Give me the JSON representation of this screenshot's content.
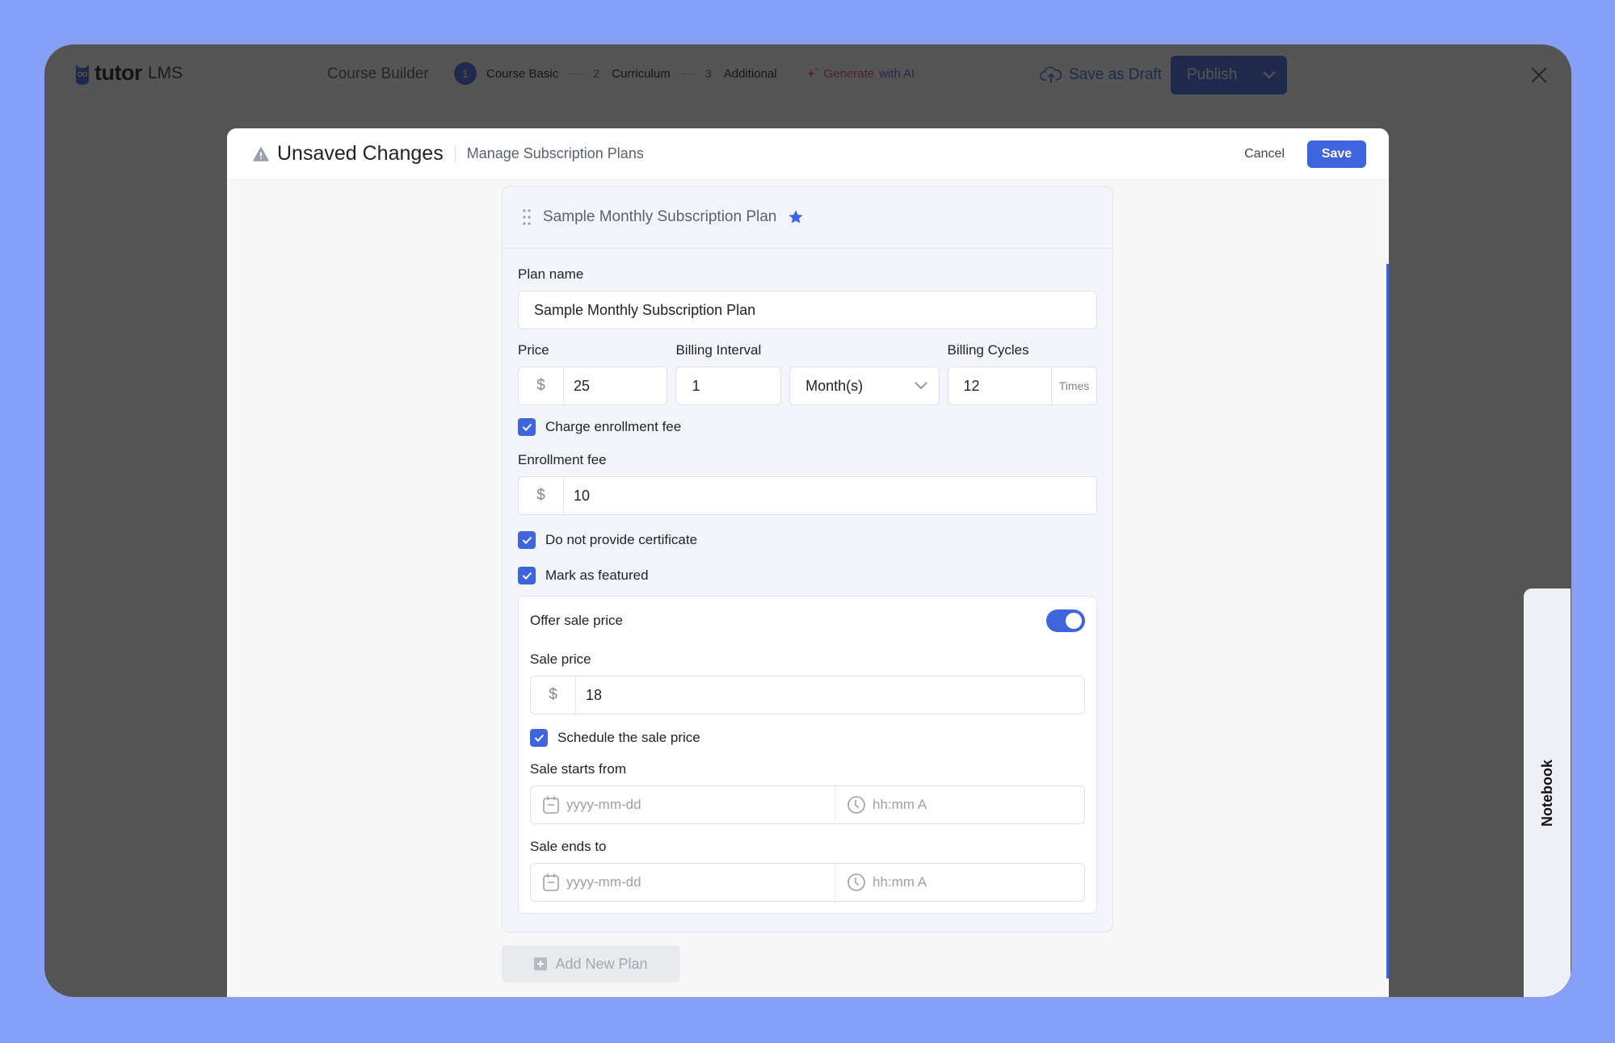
{
  "app": {
    "logo_text": "tutor",
    "logo_sub": "LMS",
    "builder_title": "Course Builder",
    "steps": [
      {
        "num": "1",
        "label": "Course Basic",
        "active": true
      },
      {
        "num": "2",
        "label": "Curriculum",
        "active": false
      },
      {
        "num": "3",
        "label": "Additional",
        "active": false
      }
    ],
    "ai_label_part1": "Generate",
    "ai_label_part2": "with AI",
    "save_draft_label": "Save as Draft",
    "publish_label": "Publish"
  },
  "modal": {
    "title": "Unsaved Changes",
    "subtitle": "Manage Subscription Plans",
    "cancel_label": "Cancel",
    "save_label": "Save"
  },
  "plan": {
    "header_title": "Sample Monthly Subscription Plan",
    "featured": true,
    "plan_name_label": "Plan name",
    "plan_name_value": "Sample Monthly Subscription Plan",
    "price_label": "Price",
    "currency_symbol": "$",
    "price_value": "25",
    "billing_interval_label": "Billing Interval",
    "billing_interval_value": "1",
    "billing_unit_value": "Month(s)",
    "billing_cycles_label": "Billing Cycles",
    "billing_cycles_value": "12",
    "billing_cycles_suffix": "Times",
    "charge_enrollment_label": "Charge enrollment fee",
    "charge_enrollment_checked": true,
    "enrollment_fee_label": "Enrollment fee",
    "enrollment_fee_value": "10",
    "no_certificate_label": "Do not provide certificate",
    "no_certificate_checked": true,
    "mark_featured_label": "Mark as featured",
    "mark_featured_checked": true,
    "offer_sale_label": "Offer sale price",
    "offer_sale_on": true,
    "sale_price_label": "Sale price",
    "sale_price_value": "18",
    "schedule_sale_label": "Schedule the sale price",
    "schedule_sale_checked": true,
    "sale_starts_label": "Sale starts from",
    "sale_ends_label": "Sale ends to",
    "date_placeholder": "yyyy-mm-dd",
    "time_placeholder": "hh:mm A"
  },
  "add_plan_label": "Add New Plan",
  "notebook_label": "Notebook",
  "colors": {
    "accent": "#3e64de",
    "background": "#85a0f6",
    "ai_red": "#d94f5c"
  }
}
